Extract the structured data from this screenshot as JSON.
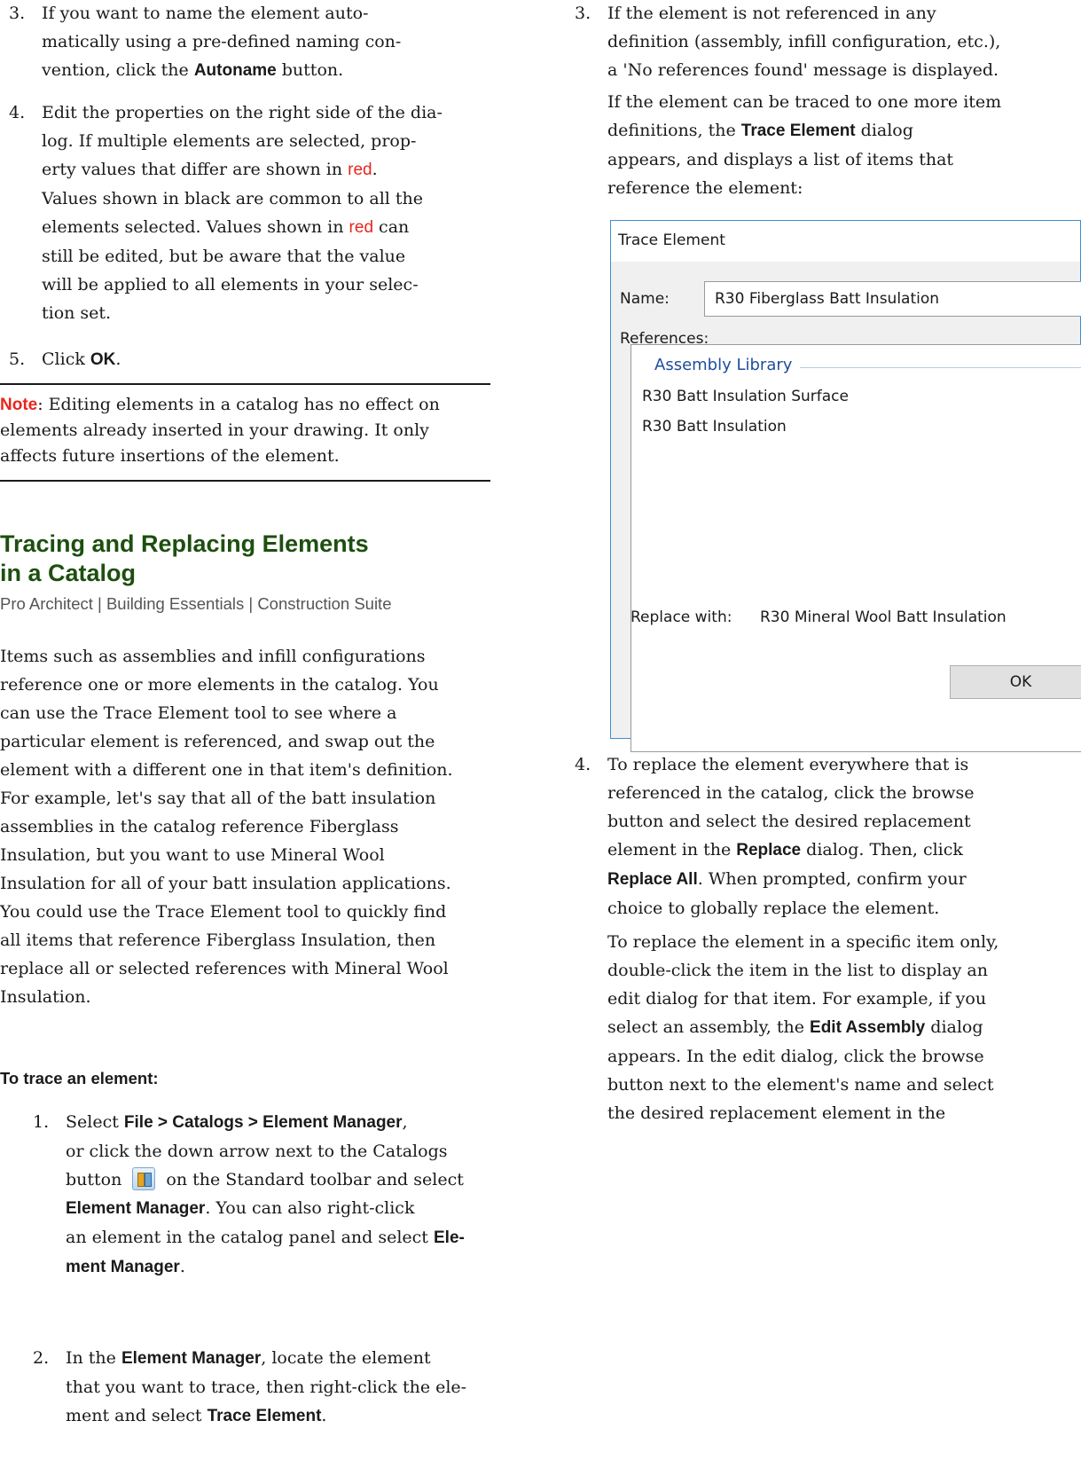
{
  "left": {
    "steps_top": [
      {
        "num": "3.",
        "html_parts": [
          "If you want to name the element auto-matically using a pre-defined naming con-vention, click the ",
          "Autoname",
          " button."
        ]
      },
      {
        "num": "4.",
        "text": "Edit the properties on the right side of the dia-log. If multiple elements are selected, prop-erty values that differ are shown in red. Values shown in black are common to all the elements selected. Values shown in red can still be edited, but be aware that the value will be applied to all elements in your selec-tion set."
      },
      {
        "num": "5.",
        "pre": "Click ",
        "bold": "OK",
        "post": "."
      }
    ],
    "step3_a": "If you want to name the element auto-",
    "step3_b": "matically using a pre-defined naming con-",
    "step3_c": "vention, click the ",
    "step3_bold": "Autoname",
    "step3_d": " button.",
    "step4_l1": "Edit the properties on the right side of the dia-",
    "step4_l2": "log. If multiple elements are selected, prop-",
    "step4_l3": "erty values that differ are shown in ",
    "red_word": "red",
    "step4_l3_end": ".",
    "step4_l4": "Values shown in black are common to all the",
    "step4_l5": "elements selected. Values shown in ",
    "step4_l5_end": " can",
    "step4_l6": "still be edited, but be aware that the value",
    "step4_l7": "will be applied to all elements in your selec-",
    "step4_l8": "tion set.",
    "step5_pre": "Click ",
    "step5_bold": "OK",
    "step5_post": ".",
    "note_label": "Note",
    "note_l1": ": Editing elements in a catalog has no effect on",
    "note_l2": "elements already inserted in your drawing. It only",
    "note_l3": "affects future insertions of the element.",
    "heading_l1": "Tracing and Replacing Elements",
    "heading_l2": "in a Catalog",
    "products": "Pro Architect | Building Essentials | Construction Suite",
    "intro": [
      "Items such as assemblies and infill configurations",
      "reference one or more elements in the catalog. You",
      "can use the Trace Element tool to see where a",
      "particular element is referenced, and swap out the",
      "element with a different one in that item's definition.",
      "For example, let's say that all of the batt insulation",
      "assemblies in the catalog reference Fiberglass",
      "Insulation, but you want to use Mineral Wool",
      "Insulation for all of your batt insulation applications.",
      "You could use the Trace Element tool to quickly find",
      "all items that reference Fiberglass Insulation, then",
      "replace all or selected references with Mineral Wool",
      "Insulation."
    ],
    "proc_head": "To trace an element:",
    "p1_pre": "Select ",
    "p1_bold1": "File > Catalogs > Element Manager",
    "p1_l1_end": ",",
    "p1_l2": "or click the down arrow next to the Catalogs",
    "p1_l3_pre": "button ",
    "p1_l3_post": " on the Standard toolbar and select",
    "p1_bold2": "Element Manager",
    "p1_l4_post": ". You can also right-click",
    "p1_l5": "an element in the catalog panel and select ",
    "p1_bold3a": "Ele-",
    "p1_bold3b": "ment Manager",
    "p1_l6_post": ".",
    "p2_pre": "In the ",
    "p2_bold1": "Element Manager",
    "p2_l1_post": ", locate the element",
    "p2_l2": "that you want to trace, then right-click the ele-",
    "p2_l3_pre": "ment and select ",
    "p2_bold2": "Trace Element",
    "p2_l3_post": ".",
    "nums": {
      "s3": "3.",
      "s4": "4.",
      "s5": "5.",
      "p1": "1.",
      "p2": "2."
    }
  },
  "right": {
    "num3": "3.",
    "r3_l1": "If the element is not referenced in any",
    "r3_l2": "definition (assembly, infill configuration, etc.),",
    "r3_l3": "a 'No references found' message is displayed.",
    "r3_l4": "If the element can be traced to one more item",
    "r3_l5_pre": "definitions, the ",
    "r3_l5_bold": "Trace Element",
    "r3_l5_post": " dialog",
    "r3_l6": "appears, and displays a list of items that",
    "r3_l7": "reference the element:",
    "dialog": {
      "title": "Trace Element",
      "name_label": "Name:",
      "name_value": "R30 Fiberglass Batt Insulation",
      "references_label": "References:",
      "group": "Assembly Library",
      "items": [
        "R30 Batt Insulation Surface",
        "R30 Batt Insulation"
      ],
      "replace_label": "Replace with:",
      "replace_value": "R30 Mineral Wool Batt Insulation",
      "ok_label": "OK"
    },
    "num4": "4.",
    "r4_l1": "To replace the element everywhere that is",
    "r4_l2": "referenced in the catalog, click the browse",
    "r4_l3": "button and select the desired replacement",
    "r4_l4_pre": "element in the ",
    "r4_l4_bold": "Replace",
    "r4_l4_post": " dialog. Then, click",
    "r4_l5_bold": "Replace All",
    "r4_l5_post": ". When prompted, confirm your",
    "r4_l6": "choice to globally replace the element.",
    "r4_l7": "To replace the element in a specific item only,",
    "r4_l8": "double-click the item in the list to display an",
    "r4_l9": "edit dialog for that item. For example, if you",
    "r4_l10_pre": "select an assembly, the ",
    "r4_l10_bold": "Edit Assembly",
    "r4_l10_post": " dialog",
    "r4_l11": "appears. In the edit dialog, click the browse",
    "r4_l12": "button next to the element's name and select",
    "r4_l13": "the desired replacement element in the"
  }
}
